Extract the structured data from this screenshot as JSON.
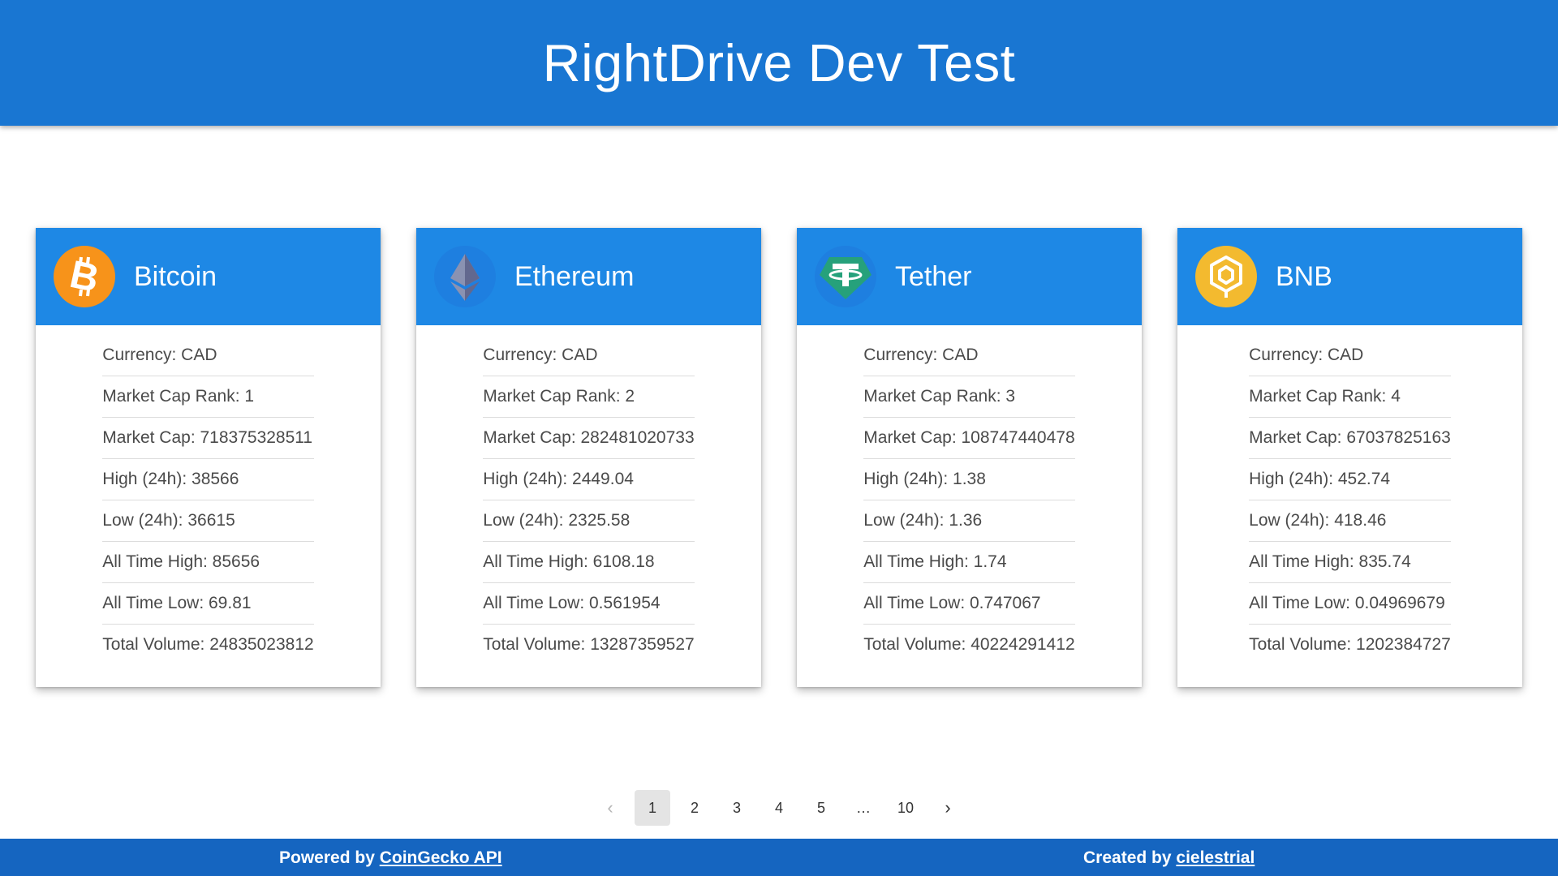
{
  "header": {
    "title": "RightDrive Dev Test"
  },
  "cards": [
    {
      "name": "Bitcoin",
      "logo_color": "#f7931a",
      "icon": "bitcoin-logo-icon",
      "stats": [
        "Currency: CAD",
        "Market Cap Rank: 1",
        "Market Cap: 718375328511",
        "High (24h): 38566",
        "Low (24h): 36615",
        "All Time High: 85656",
        "All Time Low: 69.81",
        "Total Volume: 24835023812"
      ]
    },
    {
      "name": "Ethereum",
      "logo_color": "#1e7fe0",
      "icon": "ethereum-logo-icon",
      "stats": [
        "Currency: CAD",
        "Market Cap Rank: 2",
        "Market Cap: 282481020733",
        "High (24h): 2449.04",
        "Low (24h): 2325.58",
        "All Time High: 6108.18",
        "All Time Low: 0.561954",
        "Total Volume: 13287359527"
      ]
    },
    {
      "name": "Tether",
      "logo_color": "#26a17b",
      "icon": "tether-logo-icon",
      "stats": [
        "Currency: CAD",
        "Market Cap Rank: 3",
        "Market Cap: 108747440478",
        "High (24h): 1.38",
        "Low (24h): 1.36",
        "All Time High: 1.74",
        "All Time Low: 0.747067",
        "Total Volume: 40224291412"
      ]
    },
    {
      "name": "BNB",
      "logo_color": "#f3ba2f",
      "icon": "bnb-logo-icon",
      "stats": [
        "Currency: CAD",
        "Market Cap Rank: 4",
        "Market Cap: 67037825163",
        "High (24h): 452.74",
        "Low (24h): 418.46",
        "All Time High: 835.74",
        "All Time Low: 0.04969679",
        "Total Volume: 1202384727"
      ]
    }
  ],
  "pagination": {
    "prev_icon": "chevron-left-icon",
    "next_icon": "chevron-right-icon",
    "pages": [
      "1",
      "2",
      "3",
      "4",
      "5"
    ],
    "ellipsis": "…",
    "last_page": "10",
    "current": "1"
  },
  "footer": {
    "powered_prefix": "Powered by",
    "powered_link": "CoinGecko API",
    "created_prefix": "Created by",
    "created_link": "cielestrial"
  }
}
